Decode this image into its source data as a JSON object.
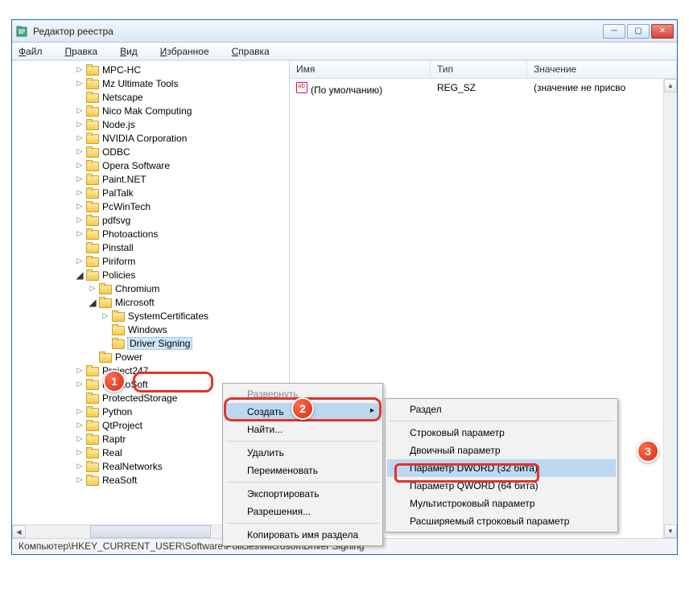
{
  "window": {
    "title": "Редактор реестра"
  },
  "menubar": {
    "file": "Файл",
    "edit": "Правка",
    "view": "Вид",
    "favorites": "Избранное",
    "help": "Справка"
  },
  "tree": {
    "items": [
      {
        "lvl": 1,
        "exp": "▷",
        "label": "MPC-HC"
      },
      {
        "lvl": 1,
        "exp": "▷",
        "label": "Mz Ultimate Tools"
      },
      {
        "lvl": 1,
        "exp": "",
        "label": "Netscape"
      },
      {
        "lvl": 1,
        "exp": "▷",
        "label": "Nico Mak Computing"
      },
      {
        "lvl": 1,
        "exp": "▷",
        "label": "Node.js"
      },
      {
        "lvl": 1,
        "exp": "▷",
        "label": "NVIDIA Corporation"
      },
      {
        "lvl": 1,
        "exp": "▷",
        "label": "ODBC"
      },
      {
        "lvl": 1,
        "exp": "▷",
        "label": "Opera Software"
      },
      {
        "lvl": 1,
        "exp": "▷",
        "label": "Paint.NET"
      },
      {
        "lvl": 1,
        "exp": "▷",
        "label": "PalTalk"
      },
      {
        "lvl": 1,
        "exp": "▷",
        "label": "PcWinTech"
      },
      {
        "lvl": 1,
        "exp": "▷",
        "label": "pdfsvg"
      },
      {
        "lvl": 1,
        "exp": "▷",
        "label": "Photoactions"
      },
      {
        "lvl": 1,
        "exp": "",
        "label": "Pinstall"
      },
      {
        "lvl": 1,
        "exp": "▷",
        "label": "Piriform"
      },
      {
        "lvl": 1,
        "exp": "▲",
        "label": "Policies"
      },
      {
        "lvl": 2,
        "exp": "▷",
        "label": "Chromium"
      },
      {
        "lvl": 2,
        "exp": "▲",
        "label": "Microsoft"
      },
      {
        "lvl": 3,
        "exp": "▷",
        "label": "SystemCertificates"
      },
      {
        "lvl": 3,
        "exp": "",
        "label": "Windows"
      },
      {
        "lvl": 3,
        "exp": "",
        "label": "Driver Signing",
        "sel": true
      },
      {
        "lvl": 2,
        "exp": "",
        "label": "Power"
      },
      {
        "lvl": 1,
        "exp": "▷",
        "label": "Project247"
      },
      {
        "lvl": 1,
        "exp": "▷",
        "label": "PromoSoft"
      },
      {
        "lvl": 1,
        "exp": "",
        "label": "ProtectedStorage"
      },
      {
        "lvl": 1,
        "exp": "▷",
        "label": "Python"
      },
      {
        "lvl": 1,
        "exp": "▷",
        "label": "QtProject"
      },
      {
        "lvl": 1,
        "exp": "▷",
        "label": "Raptr"
      },
      {
        "lvl": 1,
        "exp": "▷",
        "label": "Real"
      },
      {
        "lvl": 1,
        "exp": "▷",
        "label": "RealNetworks"
      },
      {
        "lvl": 1,
        "exp": "▷",
        "label": "ReaSoft"
      }
    ]
  },
  "list": {
    "columns": {
      "name": "Имя",
      "type": "Тип",
      "value": "Значение"
    },
    "rows": [
      {
        "name": "(По умолчанию)",
        "type": "REG_SZ",
        "value": "(значение не присво"
      }
    ]
  },
  "context1": {
    "expand": "Развернуть",
    "create": "Создать",
    "find": "Найти...",
    "delete": "Удалить",
    "rename": "Переименовать",
    "export": "Экспортировать",
    "permissions": "Разрешения...",
    "copykey": "Копировать имя раздела"
  },
  "context2": {
    "key": "Раздел",
    "string": "Строковый параметр",
    "binary": "Двоичный параметр",
    "dword": "Параметр DWORD (32 бита)",
    "qword": "Параметр QWORD (64 бита)",
    "multistring": "Мультистроковый параметр",
    "expandstring": "Расширяемый строковый параметр"
  },
  "statusbar": {
    "path": "Компьютер\\HKEY_CURRENT_USER\\Software\\Policies\\Microsoft\\Driver Signing"
  },
  "markers": {
    "m1": "1",
    "m2": "2",
    "m3": "3"
  }
}
